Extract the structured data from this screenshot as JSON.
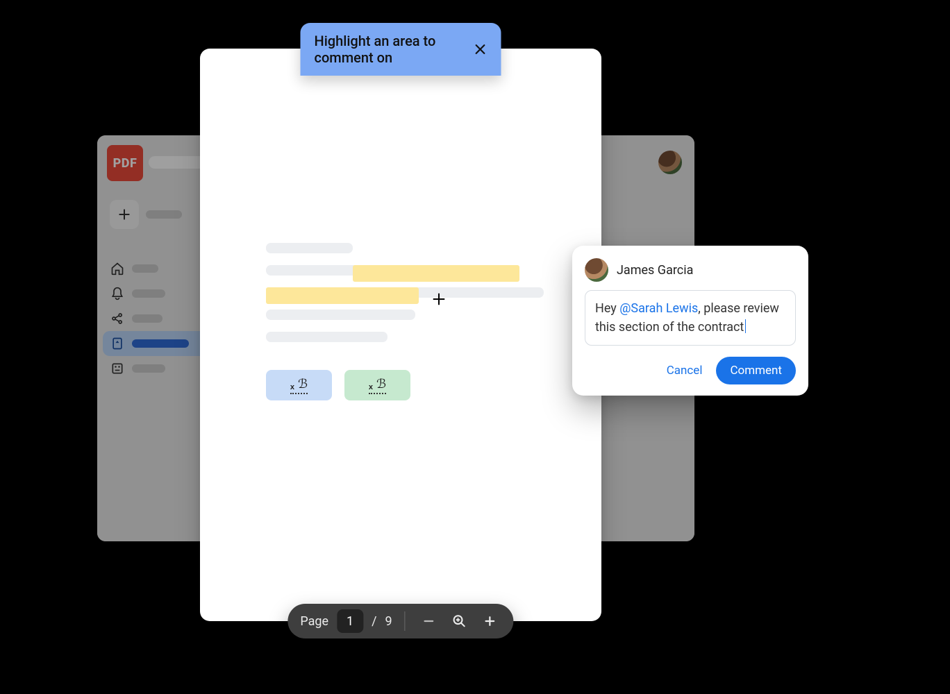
{
  "app": {
    "badge": "PDF"
  },
  "hint": {
    "text": "Highlight an area to comment on"
  },
  "sidebar": {
    "items": [
      {
        "icon": "home"
      },
      {
        "icon": "bell"
      },
      {
        "icon": "share"
      },
      {
        "icon": "file",
        "active": true
      },
      {
        "icon": "grid"
      }
    ]
  },
  "pager": {
    "label": "Page",
    "current": "1",
    "separator": "/",
    "total": "9"
  },
  "comment": {
    "author": "James Garcia",
    "text_pre": "Hey ",
    "mention": "@Sarah Lewis",
    "text_post": ", please review this section of the contract",
    "actions": {
      "cancel": "Cancel",
      "submit": "Comment"
    }
  }
}
